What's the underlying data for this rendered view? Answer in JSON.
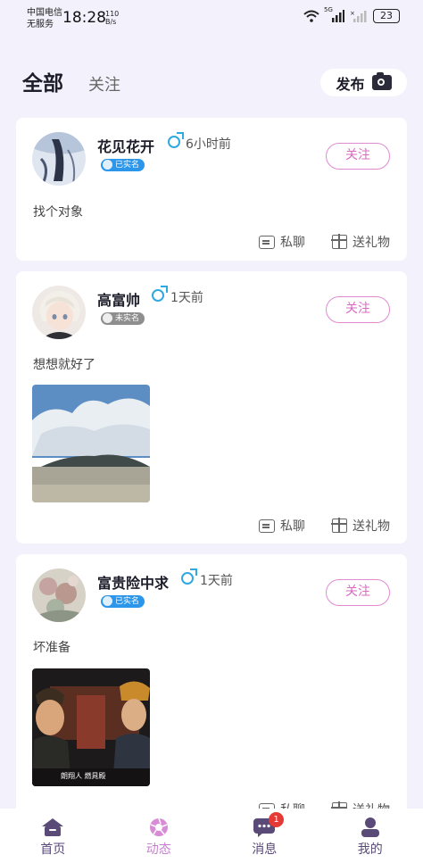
{
  "status_bar": {
    "carrier_line1": "中国电信",
    "carrier_line2": "无服务",
    "time": "18:28",
    "net_speed_value": "110",
    "net_speed_unit": "B/s",
    "signal_label": "5G",
    "battery": "23"
  },
  "top_tabs": {
    "all": "全部",
    "following": "关注"
  },
  "publish_label": "发布",
  "posts": [
    {
      "user": "花见花开",
      "time": "6小时前",
      "verification": "已实名",
      "follow": "关注",
      "text": "找个对象",
      "chat": "私聊",
      "gift": "送礼物"
    },
    {
      "user": "高富帅",
      "time": "1天前",
      "verification": "未实名",
      "follow": "关注",
      "text": "想想就好了",
      "chat": "私聊",
      "gift": "送礼物"
    },
    {
      "user": "富贵险中求",
      "time": "1天前",
      "verification": "已实名",
      "follow": "关注",
      "text": "坏准备",
      "image_caption": "朗翔人 燃晁殿",
      "chat": "私聊",
      "gift": "送礼物"
    }
  ],
  "bottom_nav": {
    "home": "首页",
    "feed": "动态",
    "messages": "消息",
    "messages_badge": "1",
    "me": "我的"
  },
  "colors": {
    "accent": "#d86bc2",
    "nav_inactive": "#5a4a78",
    "verified": "#2b96ea",
    "unverified": "#8e8e8e",
    "gender_male": "#2fa9e0"
  }
}
